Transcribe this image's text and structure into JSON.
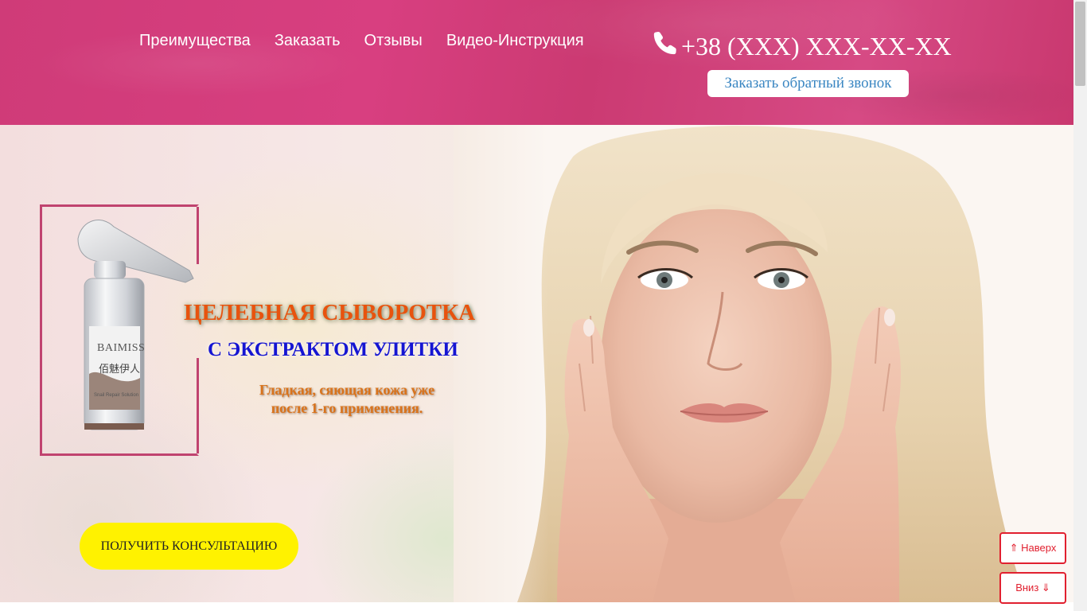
{
  "nav": {
    "items": [
      "Преимущества",
      "Заказать",
      "Отзывы",
      "Видео-Инструкция"
    ]
  },
  "contact": {
    "phone_icon": "phone-icon",
    "phone": "+38 (XXX) XXX-XX-XX",
    "callback_label": "Заказать обратный звонок"
  },
  "hero": {
    "headline": "ЦЕЛЕБНАЯ СЫВОРОТКА",
    "subheadline": "С ЭКСТРАКТОМ УЛИТКИ",
    "description_line1": "Гладкая, сяющая кожа уже",
    "description_line2": "после 1-го применения.",
    "cta_label": "ПОЛУЧИТЬ КОНСУЛЬТАЦИЮ",
    "product": {
      "brand": "BAIMISS",
      "brand_cn": "佰魅伊人",
      "label_small": "Snail Repair Solution"
    }
  },
  "scroll": {
    "up_label": "⇑ Наверх",
    "down_label": "Вниз ⇓"
  },
  "colors": {
    "header_bg": "#d23e7a",
    "cta_bg": "#fff200",
    "headline": "#e8530e",
    "subheadline": "#1515d2",
    "description": "#d9731b",
    "scroll_btn": "#e1202f"
  }
}
